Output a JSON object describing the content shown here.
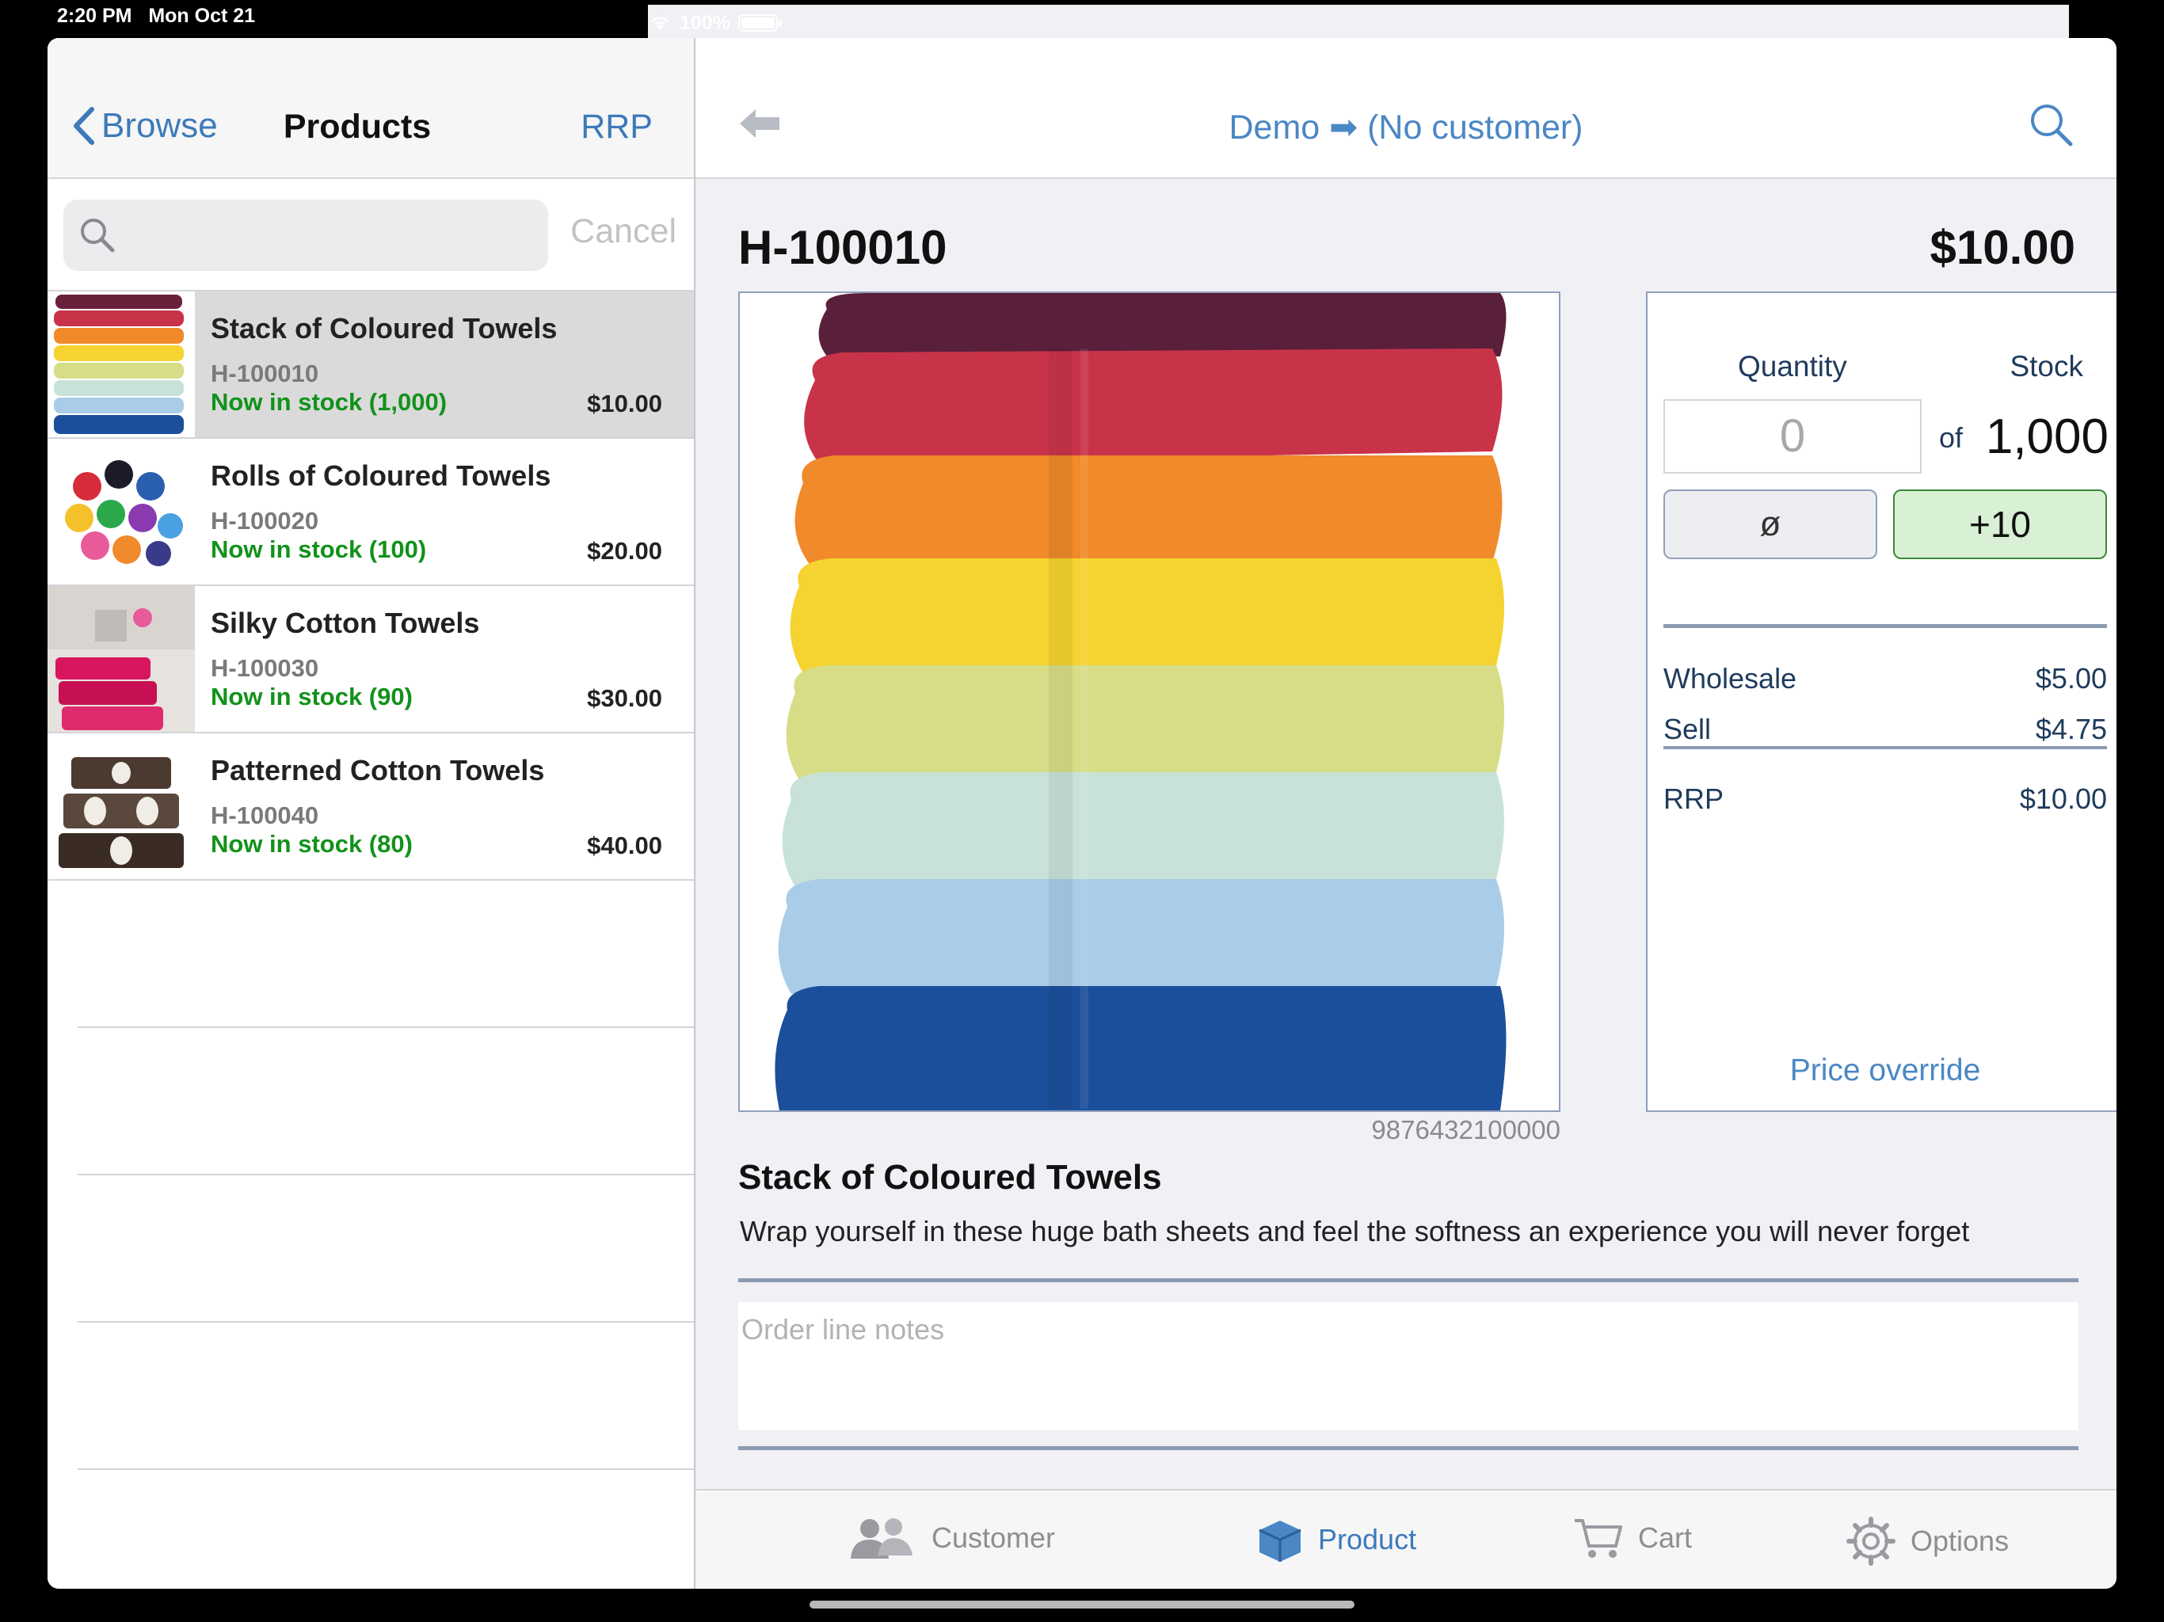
{
  "status": {
    "time": "2:20 PM",
    "date": "Mon Oct 21",
    "battery": "100%"
  },
  "left_nav": {
    "back_label": "Browse",
    "title": "Products",
    "right_label": "RRP"
  },
  "search": {
    "placeholder": "",
    "cancel_label": "Cancel"
  },
  "products": [
    {
      "name": "Stack of Coloured Towels",
      "code": "H-100010",
      "stock": "Now in stock (1,000)",
      "price": "$10.00"
    },
    {
      "name": "Rolls of Coloured Towels",
      "code": "H-100020",
      "stock": "Now in stock (100)",
      "price": "$20.00"
    },
    {
      "name": "Silky Cotton Towels",
      "code": "H-100030",
      "stock": "Now in stock (90)",
      "price": "$30.00"
    },
    {
      "name": "Patterned Cotton Towels",
      "code": "H-100040",
      "stock": "Now in stock (80)",
      "price": "$40.00"
    }
  ],
  "right_nav": {
    "title": "Demo ➡ (No customer)"
  },
  "detail": {
    "code": "H-100010",
    "price": "$10.00",
    "barcode": "9876432100000",
    "name": "Stack of Coloured Towels",
    "description": "Wrap yourself in these huge bath sheets and feel the softness an experience you will never forget",
    "notes_placeholder": "Order line notes"
  },
  "order_panel": {
    "quantity_label": "Quantity",
    "stock_label": "Stock",
    "quantity_value": "0",
    "of_label": "of",
    "stock_value": "1,000",
    "clear_label": "ø",
    "plus_label": "+10",
    "wholesale_label": "Wholesale",
    "wholesale_value": "$5.00",
    "sell_label": "Sell",
    "sell_value": "$4.75",
    "rrp_label": "RRP",
    "rrp_value": "$10.00",
    "override_label": "Price override"
  },
  "tabs": [
    {
      "label": "Customer",
      "icon": "people-icon"
    },
    {
      "label": "Product",
      "icon": "box-icon"
    },
    {
      "label": "Cart",
      "icon": "cart-icon"
    },
    {
      "label": "Options",
      "icon": "gear-icon"
    }
  ],
  "colors": {
    "accent": "#3d7ab8",
    "in_stock": "#12921a",
    "selected_row": "#dadadb"
  }
}
